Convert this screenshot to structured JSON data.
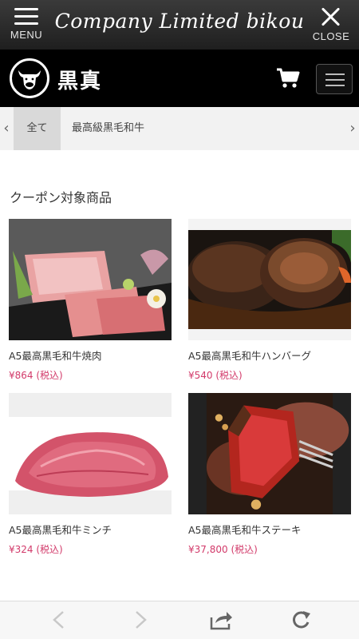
{
  "topbar": {
    "menu_label": "MENU",
    "title": "Company Limited bikou",
    "close_label": "CLOSE"
  },
  "brand": {
    "name": "黒真",
    "logo_icon": "bull-head-icon"
  },
  "tabs": {
    "items": [
      {
        "label": "全て",
        "selected": true
      },
      {
        "label": "最高級黒毛和牛",
        "selected": false
      }
    ]
  },
  "section": {
    "title": "クーポン対象商品"
  },
  "products": [
    {
      "name": "A5最高黒毛和牛焼肉",
      "price": "¥864",
      "tax": "(税込)",
      "image": "wagyu-yakiniku-platter"
    },
    {
      "name": "A5最高黒毛和牛ハンバーグ",
      "price": "¥540",
      "tax": "(税込)",
      "image": "hamburg-steak-with-sauce"
    },
    {
      "name": "A5最高黒毛和牛ミンチ",
      "price": "¥324",
      "tax": "(税込)",
      "image": "minced-beef"
    },
    {
      "name": "A5最高黒毛和牛ステーキ",
      "price": "¥37,800",
      "tax": "(税込)",
      "image": "steak-on-fork"
    }
  ],
  "colors": {
    "price": "#d23a6a",
    "header_bg": "#000000",
    "tab_bg": "#f2f2f2"
  }
}
